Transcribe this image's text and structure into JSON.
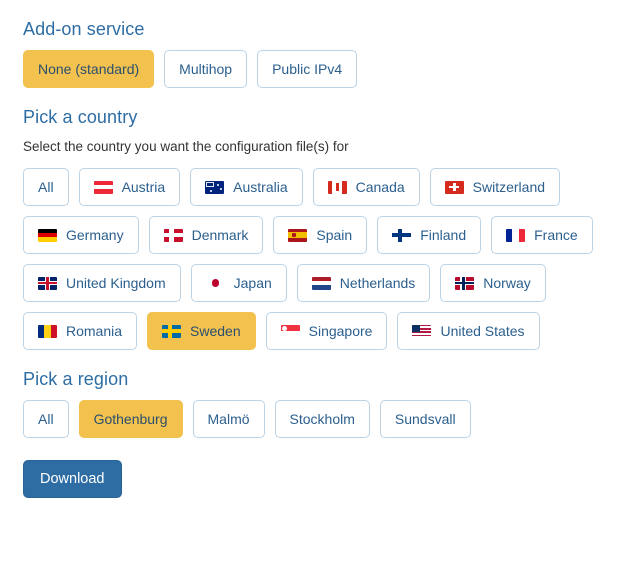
{
  "colors": {
    "heading": "#2e6da4",
    "selected_bg": "#f2c14e",
    "button_border": "#bcd3e5",
    "button_text": "#2b5f8e",
    "download_bg": "#2e6da4",
    "page_bg": "#ffffff"
  },
  "addon": {
    "heading": "Add-on service",
    "options": [
      {
        "label": "None (standard)",
        "selected": true
      },
      {
        "label": "Multihop",
        "selected": false
      },
      {
        "label": "Public IPv4",
        "selected": false
      }
    ]
  },
  "country": {
    "heading": "Pick a country",
    "subtitle": "Select the country you want the configuration file(s) for",
    "options": [
      {
        "label": "All",
        "flag": null,
        "selected": false
      },
      {
        "label": "Austria",
        "flag": "flag-austria",
        "selected": false
      },
      {
        "label": "Australia",
        "flag": "flag-australia",
        "selected": false
      },
      {
        "label": "Canada",
        "flag": "flag-canada",
        "selected": false
      },
      {
        "label": "Switzerland",
        "flag": "flag-switzerland",
        "selected": false
      },
      {
        "label": "Germany",
        "flag": "flag-germany",
        "selected": false
      },
      {
        "label": "Denmark",
        "flag": "flag-denmark",
        "selected": false
      },
      {
        "label": "Spain",
        "flag": "flag-spain",
        "selected": false
      },
      {
        "label": "Finland",
        "flag": "flag-finland",
        "selected": false
      },
      {
        "label": "France",
        "flag": "flag-france",
        "selected": false
      },
      {
        "label": "United Kingdom",
        "flag": "flag-united-kingdom",
        "selected": false
      },
      {
        "label": "Japan",
        "flag": "flag-japan",
        "selected": false
      },
      {
        "label": "Netherlands",
        "flag": "flag-netherlands",
        "selected": false
      },
      {
        "label": "Norway",
        "flag": "flag-norway",
        "selected": false
      },
      {
        "label": "Romania",
        "flag": "flag-romania",
        "selected": false
      },
      {
        "label": "Sweden",
        "flag": "flag-sweden",
        "selected": true
      },
      {
        "label": "Singapore",
        "flag": "flag-singapore",
        "selected": false
      },
      {
        "label": "United States",
        "flag": "flag-united-states",
        "selected": false
      }
    ]
  },
  "region": {
    "heading": "Pick a region",
    "options": [
      {
        "label": "All",
        "selected": false
      },
      {
        "label": "Gothenburg",
        "selected": true
      },
      {
        "label": "Malmö",
        "selected": false
      },
      {
        "label": "Stockholm",
        "selected": false
      },
      {
        "label": "Sundsvall",
        "selected": false
      }
    ]
  },
  "download": {
    "label": "Download"
  }
}
